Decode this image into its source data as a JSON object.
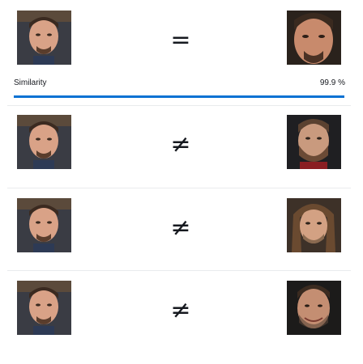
{
  "comparisons": [
    {
      "symbol": "=",
      "source_face": "face-downey",
      "target_face": "face-downey-closeup",
      "similarity_label": "Similarity",
      "similarity_value": "99.9 %",
      "similarity_fraction": 0.999
    },
    {
      "symbol": "≠",
      "source_face": "face-downey",
      "target_face": "face-bearded-dark-hair"
    },
    {
      "symbol": "≠",
      "source_face": "face-downey",
      "target_face": "face-long-brown-hair"
    },
    {
      "symbol": "≠",
      "source_face": "face-downey",
      "target_face": "face-smiling-stubble"
    }
  ],
  "colors": {
    "progress_fill": "#0972d3",
    "progress_track": "#e1e4e8",
    "divider": "#e9ebed",
    "text": "#16191f"
  }
}
